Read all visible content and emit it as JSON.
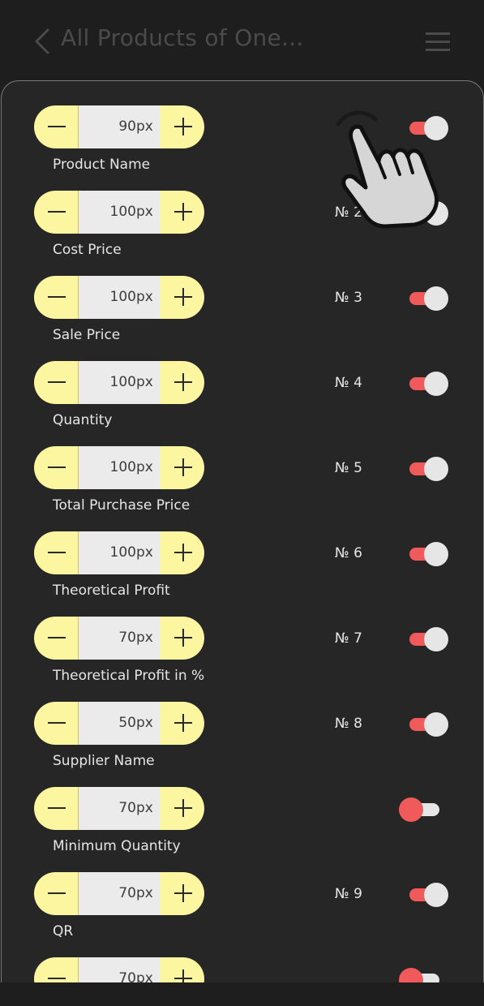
{
  "header": {
    "title": "All Products of One..."
  },
  "rows": [
    {
      "value": "90",
      "unit": "px",
      "label": "Product Name",
      "number": "",
      "toggle": "on"
    },
    {
      "value": "100",
      "unit": "px",
      "label": "Cost Price",
      "number": "№ 2",
      "toggle": "on"
    },
    {
      "value": "100",
      "unit": "px",
      "label": "Sale Price",
      "number": "№ 3",
      "toggle": "on"
    },
    {
      "value": "100",
      "unit": "px",
      "label": "Quantity",
      "number": "№ 4",
      "toggle": "on"
    },
    {
      "value": "100",
      "unit": "px",
      "label": "Total Purchase Price",
      "number": "№ 5",
      "toggle": "on"
    },
    {
      "value": "100",
      "unit": "px",
      "label": "Theoretical Profit",
      "number": "№ 6",
      "toggle": "on"
    },
    {
      "value": "70",
      "unit": "px",
      "label": "Theoretical Profit in %",
      "number": "№ 7",
      "toggle": "on"
    },
    {
      "value": "50",
      "unit": "px",
      "label": "Supplier Name",
      "number": "№ 8",
      "toggle": "on"
    },
    {
      "value": "70",
      "unit": "px",
      "label": "Minimum Quantity",
      "number": "",
      "toggle": "off"
    },
    {
      "value": "70",
      "unit": "px",
      "label": "QR",
      "number": "№ 9",
      "toggle": "on"
    },
    {
      "value": "70",
      "unit": "px",
      "label": "",
      "number": "",
      "toggle": "off"
    }
  ],
  "colors": {
    "background": "#1e1e1e",
    "panel": "#262626",
    "stepper_button": "#fdf6a0",
    "stepper_value_bg": "#ebebeb",
    "toggle_accent": "#f05a5a"
  },
  "icons": {
    "back": "chevron-left-icon",
    "menu": "hamburger-menu-icon",
    "hand": "tap-hand-icon"
  }
}
